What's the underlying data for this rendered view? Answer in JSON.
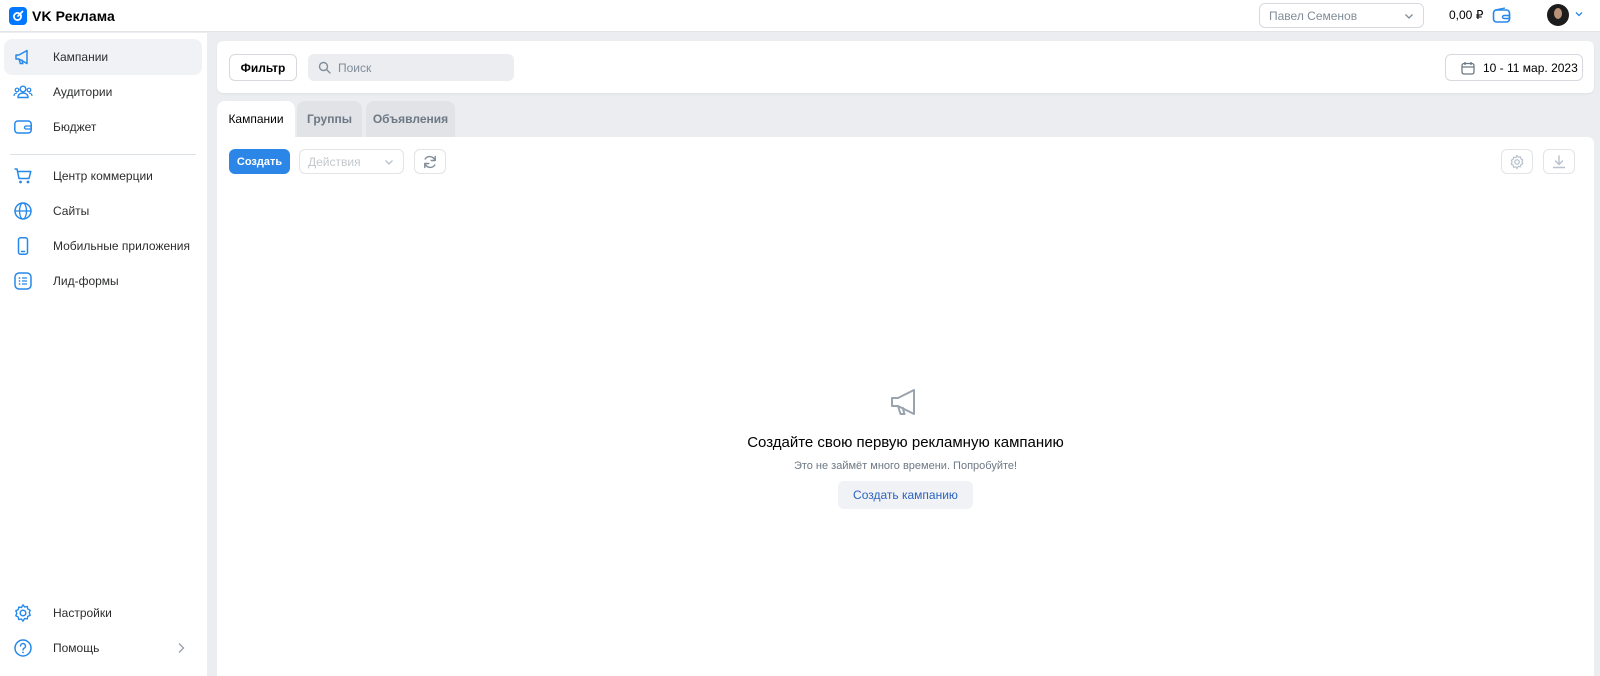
{
  "header": {
    "app_name": "VK Реклама",
    "account_select": {
      "value": "Павел Семенов"
    },
    "balance": "0,00 ₽"
  },
  "sidebar": {
    "items": [
      {
        "id": "campaigns",
        "label": "Кампании",
        "icon": "megaphone-icon",
        "active": true
      },
      {
        "id": "audiences",
        "label": "Аудитории",
        "icon": "users-icon"
      },
      {
        "id": "budget",
        "label": "Бюджет",
        "icon": "wallet-icon"
      },
      {
        "id": "commerce",
        "label": "Центр коммерции",
        "icon": "cart-icon"
      },
      {
        "id": "sites",
        "label": "Сайты",
        "icon": "globe-icon"
      },
      {
        "id": "apps",
        "label": "Мобильные приложения",
        "icon": "smartphone-icon"
      },
      {
        "id": "leadforms",
        "label": "Лид-формы",
        "icon": "list-icon"
      }
    ],
    "bottom": [
      {
        "id": "settings",
        "label": "Настройки",
        "icon": "gear-icon"
      },
      {
        "id": "help",
        "label": "Помощь",
        "icon": "help-icon"
      }
    ]
  },
  "toolbar": {
    "filter_label": "Фильтр",
    "search_placeholder": "Поиск",
    "date_range": "10 - 11 мар. 2023"
  },
  "tabs": [
    {
      "label": "Кампании",
      "active": true
    },
    {
      "label": "Группы"
    },
    {
      "label": "Объявления"
    }
  ],
  "content": {
    "create_label": "Создать",
    "actions_placeholder": "Действия",
    "empty": {
      "title": "Создайте свою первую рекламную кампанию",
      "subtitle": "Это не займёт много времени. Попробуйте!",
      "button": "Создать кампанию"
    }
  },
  "colors": {
    "accent": "#0077ff",
    "primary_button": "#2b86e8",
    "link": "#2c63bf",
    "icon": "#2688eb"
  }
}
